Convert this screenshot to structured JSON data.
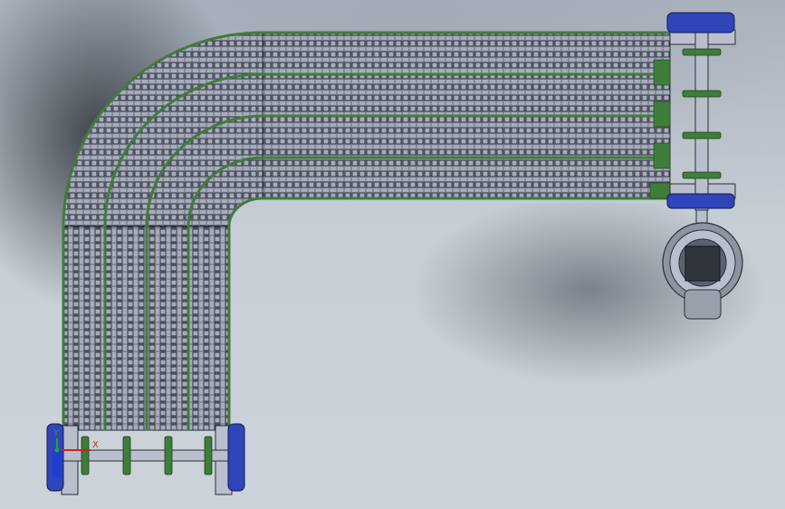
{
  "viewport": {
    "triad": {
      "x_label": "X",
      "y_label": "Y"
    }
  },
  "colors": {
    "belt": "#a6acbd",
    "belt_outline": "#2b2e35",
    "guide": "#3f7d3a",
    "frame": "#b9bfcc",
    "bearing": "#2f45b8",
    "motor": "#8d939f",
    "axis_x": "#d11f1f",
    "axis_y": "#1faa2b",
    "axis_z": "#1f3fd1"
  },
  "icons": {
    "triad": "coordinate-axis-triad-icon"
  }
}
